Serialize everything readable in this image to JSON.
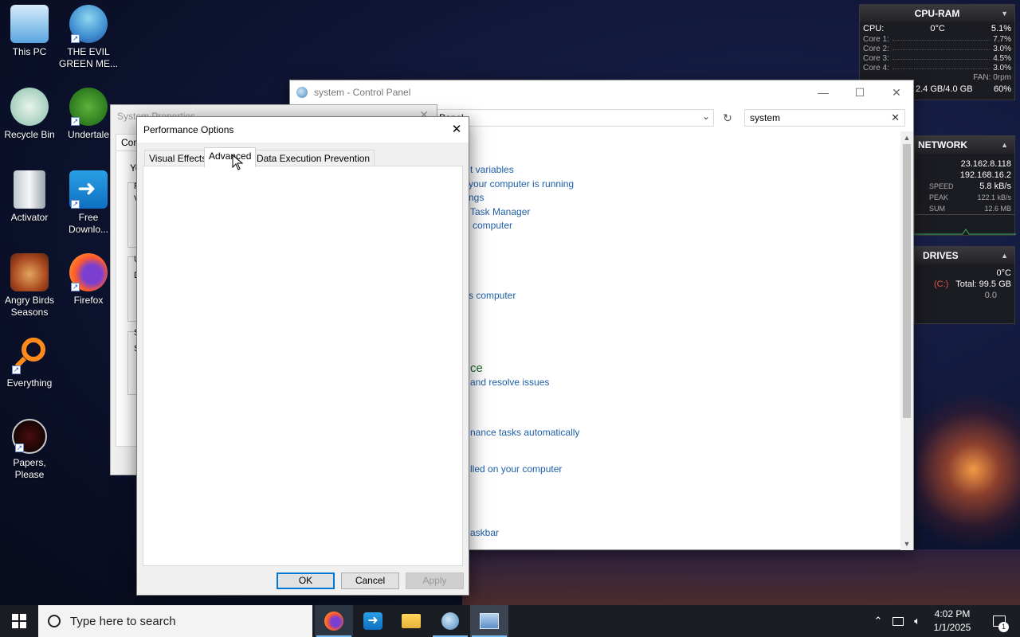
{
  "desktop": {
    "icons": [
      {
        "label": "This PC",
        "icon": "this-pc-icon"
      },
      {
        "label": "THE EVIL GREEN ME...",
        "icon": "evil-green-me-icon"
      },
      {
        "label": "Recycle Bin",
        "icon": "recycle-bin-icon"
      },
      {
        "label": "Undertale",
        "icon": "undertale-icon"
      },
      {
        "label": "Activator",
        "icon": "activator-icon"
      },
      {
        "label": "Free Downlo...",
        "icon": "free-download-manager-icon"
      },
      {
        "label": "Angry Birds Seasons",
        "icon": "angry-birds-icon"
      },
      {
        "label": "Firefox",
        "icon": "firefox-icon"
      },
      {
        "label": "Everything",
        "icon": "everything-search-icon"
      },
      {
        "label": "Papers, Please",
        "icon": "papers-please-icon"
      }
    ]
  },
  "gadget": {
    "cpu_ram": {
      "title": "CPU-RAM",
      "cpu_label": "CPU:",
      "cpu_temp": "0°C",
      "cpu_usage": "5.1%",
      "cores": [
        {
          "label": "Core 1:",
          "value": "7.7%"
        },
        {
          "label": "Core 2:",
          "value": "3.0%"
        },
        {
          "label": "Core 3:",
          "value": "4.5%"
        },
        {
          "label": "Core 4:",
          "value": "3.0%"
        }
      ],
      "fan": "FAN: 0rpm",
      "ram": "2.4 GB/4.0 GB",
      "ram_pct": "60%"
    },
    "network": {
      "title": "NETWORK",
      "ip_external": "23.162.8.118",
      "ip_internal": "192.168.16.2",
      "speed_label": "SPEED",
      "speed": "5.8 kB/s",
      "peak_label": "PEAK",
      "peak": "122.1 kB/s",
      "sum_label": "SUM",
      "sum": "12.6 MB"
    },
    "drives": {
      "title": "DRIVES",
      "temp": "0°C",
      "drive": "(C:)",
      "total": "Total: 99.5 GB",
      "activity": "0.0"
    }
  },
  "control_panel": {
    "title": "system - Control Panel",
    "address": "Panel",
    "search_value": "system",
    "links": [
      "t variables",
      "your computer is running",
      "ngs",
      "Task Manager",
      "computer",
      "s computer",
      "and resolve issues",
      "nance tasks automatically",
      "lled on your computer",
      "askbar"
    ],
    "heading": "ce"
  },
  "system_properties": {
    "title": "System Properties",
    "tab_fragment": "Com",
    "fragments": [
      "Yo",
      "F",
      "V",
      "U",
      "D",
      "S",
      "S"
    ]
  },
  "performance_options": {
    "title": "Performance Options",
    "tabs": [
      "Visual Effects",
      "Advanced",
      "Data Execution Prevention"
    ],
    "active_tab": "Advanced",
    "ok": "OK",
    "cancel": "Cancel",
    "apply": "Apply"
  },
  "taskbar": {
    "search_placeholder": "Type here to search",
    "apps": [
      "firefox-icon",
      "free-download-manager-icon",
      "file-explorer-icon",
      "control-panel-icon",
      "system-properties-icon"
    ],
    "time": "4:02 PM",
    "date": "1/1/2025",
    "notification_count": "1"
  },
  "colors": {
    "link": "#1e5fa8",
    "accent": "#0078d7",
    "taskbar": "#1a1d24"
  }
}
